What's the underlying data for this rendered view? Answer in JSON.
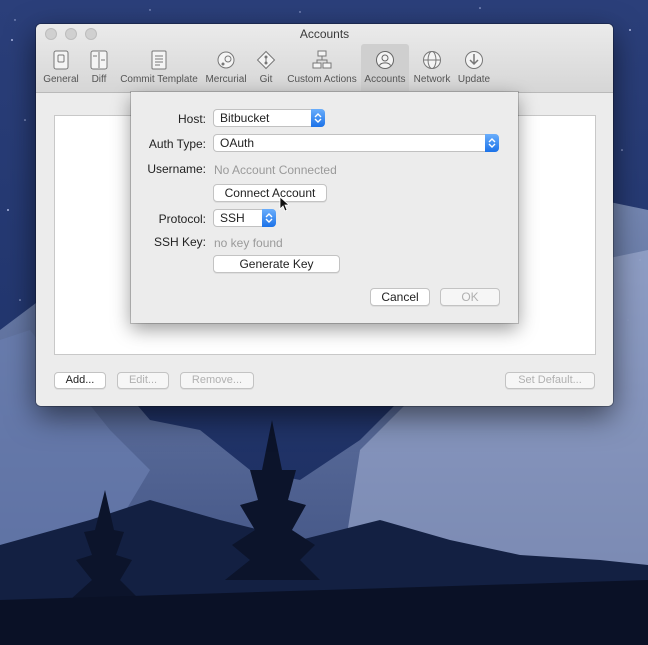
{
  "window": {
    "title": "Accounts"
  },
  "toolbar": {
    "items": [
      {
        "label": "General",
        "icon": "general-icon"
      },
      {
        "label": "Diff",
        "icon": "diff-icon"
      },
      {
        "label": "Commit Template",
        "icon": "commit-template-icon"
      },
      {
        "label": "Mercurial",
        "icon": "mercurial-icon"
      },
      {
        "label": "Git",
        "icon": "git-icon"
      },
      {
        "label": "Custom Actions",
        "icon": "custom-actions-icon"
      },
      {
        "label": "Accounts",
        "icon": "accounts-icon",
        "selected": true
      },
      {
        "label": "Network",
        "icon": "network-icon"
      },
      {
        "label": "Update",
        "icon": "update-icon"
      }
    ]
  },
  "main": {
    "add_label": "Add...",
    "edit_label": "Edit...",
    "remove_label": "Remove...",
    "set_default_label": "Set Default..."
  },
  "sheet": {
    "host_label": "Host:",
    "host_value": "Bitbucket",
    "auth_type_label": "Auth Type:",
    "auth_type_value": "OAuth",
    "username_label": "Username:",
    "username_value": "No Account Connected",
    "connect_account_label": "Connect Account",
    "protocol_label": "Protocol:",
    "protocol_value": "SSH",
    "ssh_key_label": "SSH Key:",
    "ssh_key_value": "no key found",
    "generate_key_label": "Generate Key",
    "cancel_label": "Cancel",
    "ok_label": "OK"
  },
  "colors": {
    "accent": "#1c72e8",
    "desktop_sky": "#1a2a55"
  }
}
